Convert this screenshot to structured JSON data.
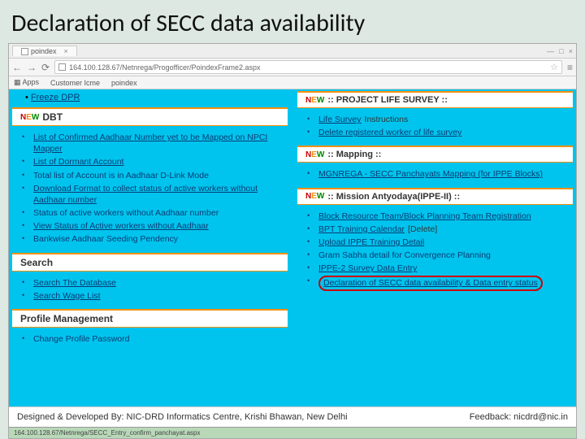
{
  "title": "Declaration of SECC data availability",
  "browser": {
    "tab_label": "poindex",
    "url": "164.100.128.67/Netnrega/Progofficer/PoindexFrame2.aspx",
    "bookmarks": [
      "Apps",
      "Customer Icme",
      "poindex"
    ]
  },
  "left": {
    "freeze": "Freeze DPR",
    "sections": [
      {
        "head": "DBT",
        "new": true,
        "items": [
          {
            "text": "List of Confirmed Aadhaar Number yet to be Mapped on NPCI Mapper",
            "link": true
          },
          {
            "text": "List of Dormant Account",
            "link": true
          },
          {
            "text": "Total list of Account is in Aadhaar D-Link Mode",
            "link": false
          },
          {
            "text": "Download Format to collect status of active workers without Aadhaar number",
            "link": true
          },
          {
            "text": "Status of active workers without Aadhaar number",
            "link": false
          },
          {
            "text": "View Status of Active workers without Aadhaar",
            "link": true
          },
          {
            "text": "Bankwise Aadhaar Seeding Pendency",
            "link": false
          }
        ]
      },
      {
        "head": "Search",
        "new": false,
        "items": [
          {
            "text": "Search The Database",
            "link": true
          },
          {
            "text": "Search Wage List",
            "link": true
          }
        ]
      },
      {
        "head": "Profile Management",
        "new": false,
        "items": [
          {
            "text": "Change Profile Password",
            "link": false
          }
        ]
      }
    ]
  },
  "right": {
    "sections": [
      {
        "head": ":: PROJECT LIFE SURVEY ::",
        "new": true,
        "items": [
          {
            "text": "Life Survey",
            "link": true,
            "extra": "Instructions"
          },
          {
            "text": "Delete registered worker of life survey",
            "link": true
          }
        ]
      },
      {
        "head": ":: Mapping ::",
        "new": true,
        "items": [
          {
            "text": "MGNREGA - SECC Panchayats Mapping (for IPPE Blocks)",
            "link": true
          }
        ]
      },
      {
        "head": ":: Mission Antyodaya(IPPE-II) ::",
        "new": true,
        "items": [
          {
            "text": "Block Resource Team/Block Planning Team Registration",
            "link": true
          },
          {
            "text": "BPT Training Calendar",
            "link": true,
            "extra": "[Delete]"
          },
          {
            "text": "Upload IPPE Training Detail",
            "link": true
          },
          {
            "text": "Gram Sabha detail for Convergence Planning",
            "link": false
          },
          {
            "text": "IPPE-2 Survey Data Entry",
            "link": true
          },
          {
            "text": "Declaration of SECC data availability & Data entry status",
            "link": true,
            "highlight": true
          }
        ]
      }
    ]
  },
  "footer": {
    "credit": "Designed & Developed By: NIC-DRD Informatics Centre, Krishi Bhawan, New Delhi",
    "feedback": "Feedback: nicdrd@nic.in",
    "status": "164.100.128.67/Netnrega/SECC_Entry_confirm_panchayat.aspx"
  }
}
